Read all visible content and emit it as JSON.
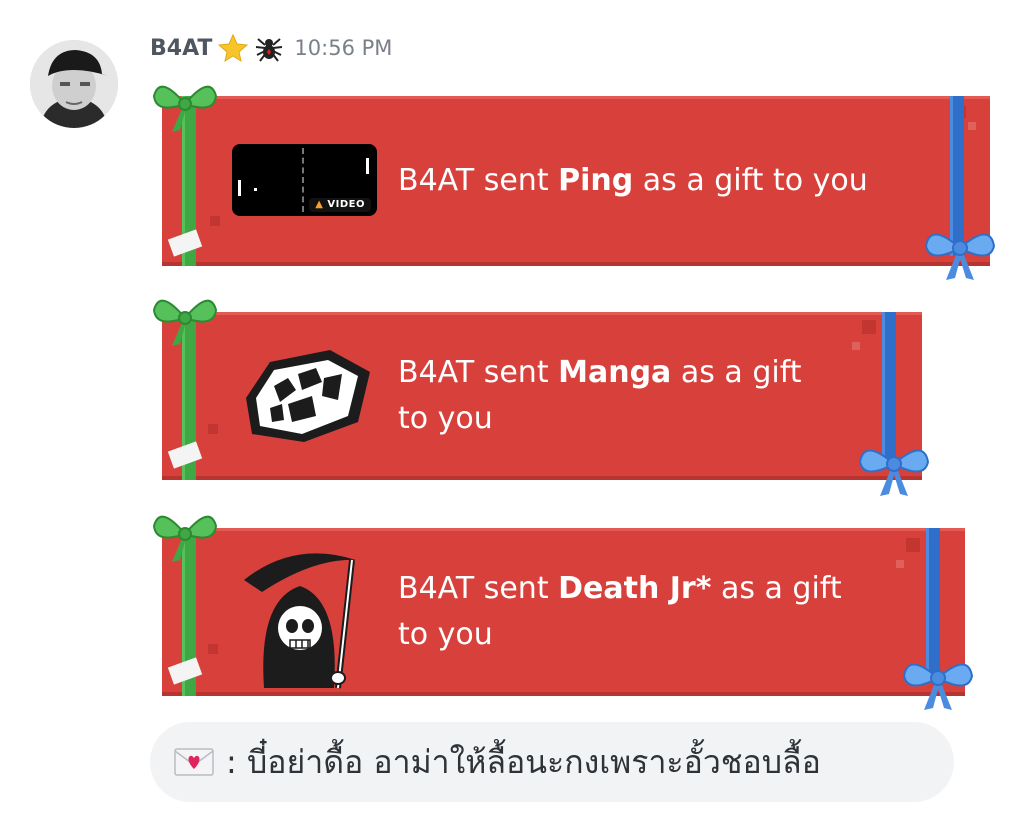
{
  "message_header": {
    "username": "B4AT",
    "badges": [
      "star-emoji",
      "spider-emoji"
    ],
    "timestamp": "10:56 PM"
  },
  "gifts": [
    {
      "prefix": "B4AT sent ",
      "item": "Ping",
      "suffix_line1": " as a gift to you",
      "line2": "",
      "thumbnail": "ping-game-video",
      "video_badge": "VIDEO"
    },
    {
      "prefix": "B4AT sent ",
      "item": "Manga",
      "suffix_line1": " as a gift",
      "line2": "to you",
      "thumbnail": "manga-shards-icon"
    },
    {
      "prefix": "B4AT sent ",
      "item": "Death Jr*",
      "suffix_line1": " as a gift",
      "line2": "to you",
      "thumbnail": "grim-reaper-icon"
    }
  ],
  "text_message": {
    "emoji": "love-letter-emoji",
    "text": " : บี๋อย่าดื้อ อาม่าให้ลื้อนะกงเพราะอั้วชอบลื้อ"
  },
  "colors": {
    "gift_red": "#d8403c",
    "ribbon_green": "#3fa744",
    "ribbon_blue": "#2f6fc9",
    "username_gray": "#4f5660",
    "bubble_bg": "#f2f3f5"
  }
}
